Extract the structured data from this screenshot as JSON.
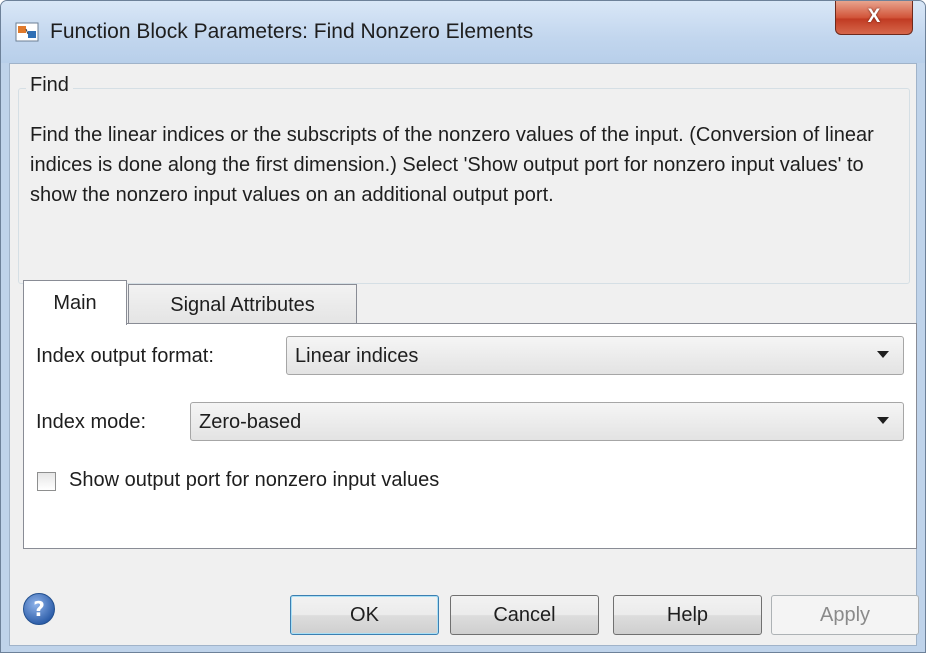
{
  "window": {
    "title": "Function Block Parameters: Find Nonzero Elements",
    "close_glyph": "X"
  },
  "group": {
    "legend": "Find",
    "description": "Find the linear indices or the subscripts of the nonzero values of the input. (Conversion of linear indices is done along the first dimension.) Select 'Show output port for nonzero input values' to show the nonzero input values on an additional output port."
  },
  "tabs": [
    {
      "label": "Main",
      "selected": true
    },
    {
      "label": "Signal Attributes",
      "selected": false
    }
  ],
  "main": {
    "index_output_format_label": "Index output format:",
    "index_output_format_value": "Linear indices",
    "index_mode_label": "Index mode:",
    "index_mode_value": "Zero-based",
    "show_output_port_label": "Show output port for nonzero input values",
    "show_output_port_checked": false
  },
  "buttons": {
    "ok": "OK",
    "cancel": "Cancel",
    "help": "Help",
    "apply": "Apply"
  },
  "icons": {
    "app": "simulink-block-icon",
    "help": "question-circle-icon",
    "dropdown": "triangle-down-icon"
  }
}
